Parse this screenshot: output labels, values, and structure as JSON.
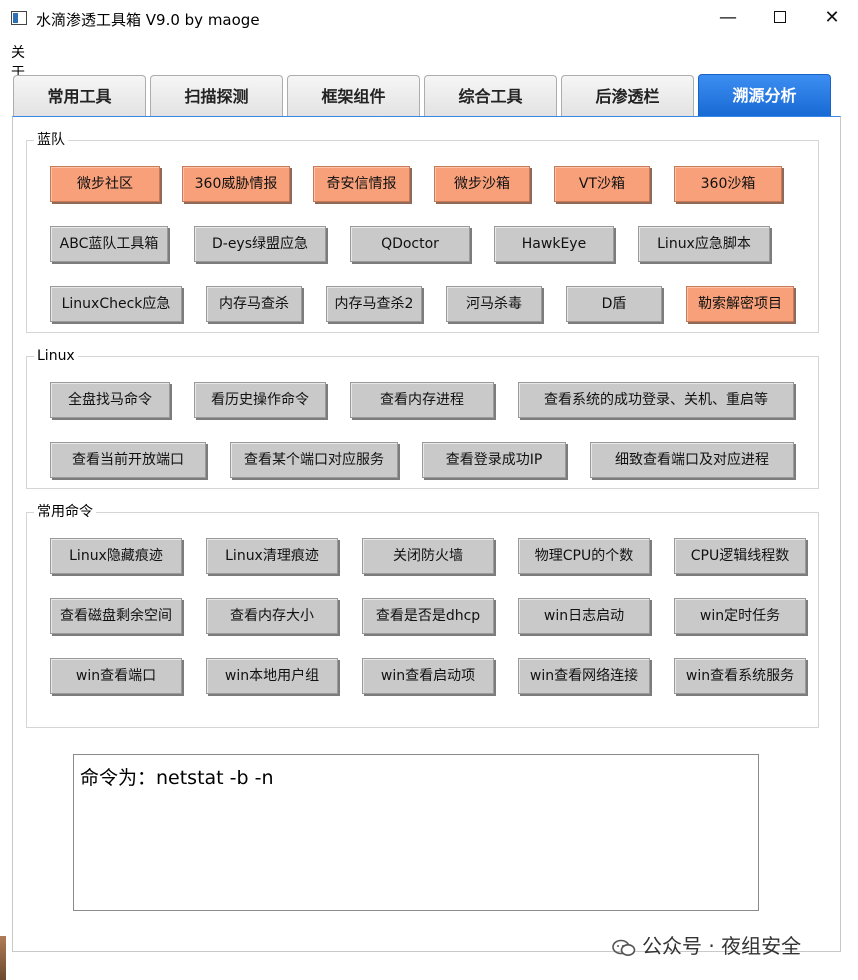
{
  "window": {
    "title": "水滴渗透工具箱 V9.0 by maoge",
    "minimize": "—",
    "close": "✕"
  },
  "menu": {
    "about": "关于"
  },
  "tabs": [
    "常用工具",
    "扫描探测",
    "框架组件",
    "综合工具",
    "后渗透栏",
    "溯源分析"
  ],
  "active_tab": "溯源分析",
  "groups": {
    "blue_team": {
      "title": "蓝队",
      "buttons": [
        "微步社区",
        "360威胁情报",
        "奇安信情报",
        "微步沙箱",
        "VT沙箱",
        "360沙箱",
        "ABC蓝队工具箱",
        "D-eys绿盟应急",
        "QDoctor",
        "HawkEye",
        "Linux应急脚本",
        "LinuxCheck应急",
        "内存马查杀",
        "内存马查杀2",
        "河马杀毒",
        "D盾",
        "勒索解密项目"
      ]
    },
    "linux": {
      "title": "Linux",
      "buttons": [
        "全盘找马命令",
        "看历史操作命令",
        "查看内存进程",
        "查看系统的成功登录、关机、重启等",
        "查看当前开放端口",
        "查看某个端口对应服务",
        "查看登录成功IP",
        "细致查看端口及对应进程"
      ]
    },
    "common": {
      "title": "常用命令",
      "buttons": [
        "Linux隐藏痕迹",
        "Linux清理痕迹",
        "关闭防火墙",
        "物理CPU的个数",
        "CPU逻辑线程数",
        "查看磁盘剩余空间",
        "查看内存大小",
        "查看是否是dhcp",
        "win日志启动",
        "win定时任务",
        "win查看端口",
        "win本地用户组",
        "win查看启动项",
        "win查看网络连接",
        "win查看系统服务"
      ]
    }
  },
  "output_text": "命令为：netstat -b -n",
  "watermark": "公众号 · 夜组安全",
  "colors": {
    "accent": "#1769d3",
    "button_orange": "#f7a07a",
    "button_gray": "#c9c9c9"
  }
}
